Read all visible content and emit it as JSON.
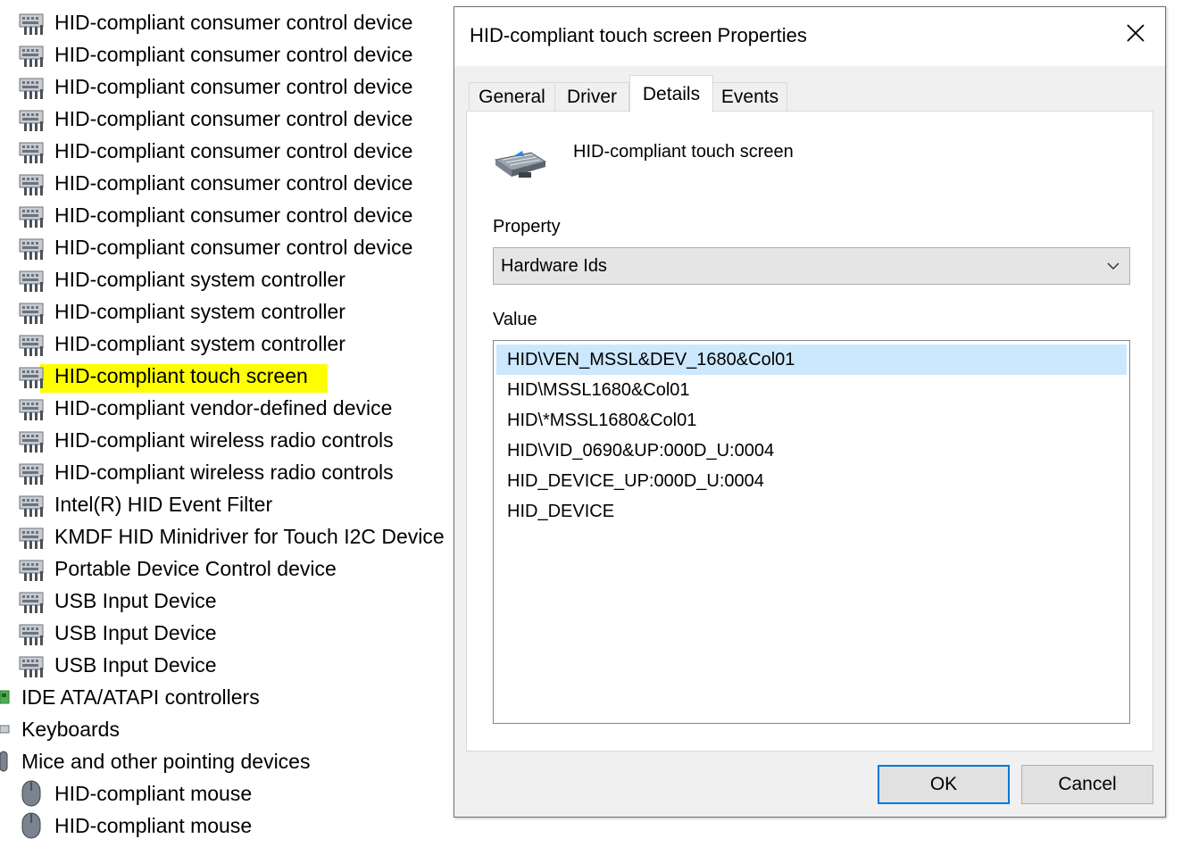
{
  "tree": {
    "items": [
      {
        "label": "HID-compliant consumer control device",
        "icon": "hid-device-icon"
      },
      {
        "label": "HID-compliant consumer control device",
        "icon": "hid-device-icon"
      },
      {
        "label": "HID-compliant consumer control device",
        "icon": "hid-device-icon"
      },
      {
        "label": "HID-compliant consumer control device",
        "icon": "hid-device-icon"
      },
      {
        "label": "HID-compliant consumer control device",
        "icon": "hid-device-icon"
      },
      {
        "label": "HID-compliant consumer control device",
        "icon": "hid-device-icon"
      },
      {
        "label": "HID-compliant consumer control device",
        "icon": "hid-device-icon"
      },
      {
        "label": "HID-compliant consumer control device",
        "icon": "hid-device-icon"
      },
      {
        "label": "HID-compliant system controller",
        "icon": "hid-device-icon"
      },
      {
        "label": "HID-compliant system controller",
        "icon": "hid-device-icon"
      },
      {
        "label": "HID-compliant system controller",
        "icon": "hid-device-icon"
      },
      {
        "label": "HID-compliant touch screen",
        "icon": "hid-device-icon",
        "highlighted": true
      },
      {
        "label": "HID-compliant vendor-defined device",
        "icon": "hid-device-icon"
      },
      {
        "label": "HID-compliant wireless radio controls",
        "icon": "hid-device-icon"
      },
      {
        "label": "HID-compliant wireless radio controls",
        "icon": "hid-device-icon"
      },
      {
        "label": "Intel(R) HID Event Filter",
        "icon": "hid-device-icon"
      },
      {
        "label": "KMDF HID Minidriver for Touch I2C Device",
        "icon": "hid-device-icon"
      },
      {
        "label": "Portable Device Control device",
        "icon": "hid-device-icon"
      },
      {
        "label": "USB Input Device",
        "icon": "hid-device-icon"
      },
      {
        "label": "USB Input Device",
        "icon": "hid-device-icon"
      },
      {
        "label": "USB Input Device",
        "icon": "hid-device-icon"
      },
      {
        "label": "IDE ATA/ATAPI controllers",
        "icon": "ide-controller-icon"
      },
      {
        "label": "Keyboards",
        "icon": "keyboard-icon"
      },
      {
        "label": "Mice and other pointing devices",
        "icon": "mouse-category-icon"
      },
      {
        "label": "HID-compliant mouse",
        "icon": "mouse-icon"
      },
      {
        "label": "HID-compliant mouse",
        "icon": "mouse-icon"
      }
    ],
    "highlight_color": "#fdff00"
  },
  "dialog": {
    "title": "HID-compliant touch screen Properties",
    "close_icon": "close-icon",
    "tabs": [
      {
        "label": "General"
      },
      {
        "label": "Driver"
      },
      {
        "label": "Details",
        "active": true
      },
      {
        "label": "Events"
      }
    ],
    "device_name": "HID-compliant touch screen",
    "device_icon": "touch-screen-device-icon",
    "property_label": "Property",
    "property_value": "Hardware Ids",
    "value_label": "Value",
    "values": [
      "HID\\VEN_MSSL&DEV_1680&Col01",
      "HID\\MSSL1680&Col01",
      "HID\\*MSSL1680&Col01",
      "HID\\VID_0690&UP:000D_U:0004",
      "HID_DEVICE_UP:000D_U:0004",
      "HID_DEVICE"
    ],
    "selected_value_index": 0,
    "ok_label": "OK",
    "cancel_label": "Cancel"
  },
  "colors": {
    "selection": "#cce8ff",
    "default_button_border": "#0078d7",
    "dialog_background": "#f0f0f0"
  }
}
